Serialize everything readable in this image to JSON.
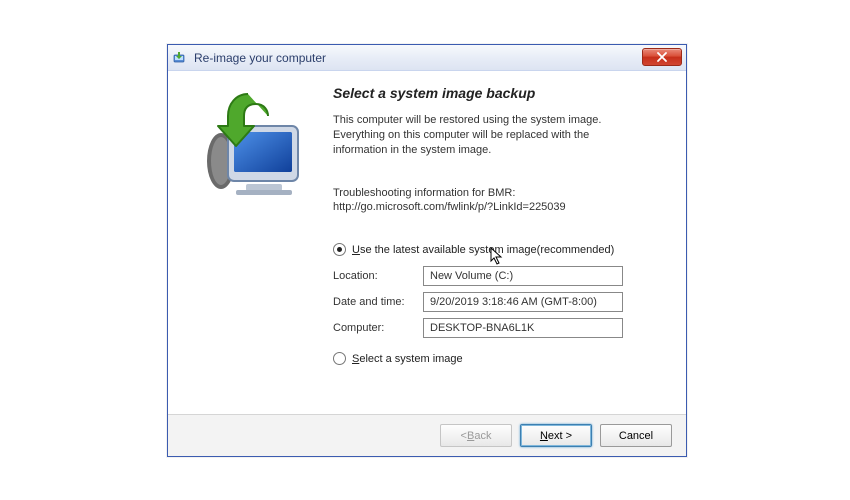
{
  "window": {
    "title": "Re-image your computer"
  },
  "heading": "Select a system image backup",
  "description": "This computer will be restored using the system image. Everything on this computer will be replaced with the information in the system image.",
  "troubleshoot": {
    "line1": "Troubleshooting information for BMR:",
    "line2": "http://go.microsoft.com/fwlink/p/?LinkId=225039"
  },
  "options": {
    "latest": {
      "prefixUnderline": "U",
      "rest": "se the latest available system image(recommended)",
      "selected": true
    },
    "select": {
      "prefixUnderline": "S",
      "rest": "elect a system image",
      "selected": false
    }
  },
  "fields": {
    "locationLabel": "Location:",
    "locationValue": "New Volume (C:)",
    "dateLabel": "Date and time:",
    "dateValue": "9/20/2019 3:18:46 AM (GMT-8:00)",
    "computerLabel": "Computer:",
    "computerValue": "DESKTOP-BNA6L1K"
  },
  "buttons": {
    "backPrefix": "< ",
    "backUnderline": "B",
    "backRest": "ack",
    "nextUnderline": "N",
    "nextRest": "ext >",
    "cancel": "Cancel"
  }
}
